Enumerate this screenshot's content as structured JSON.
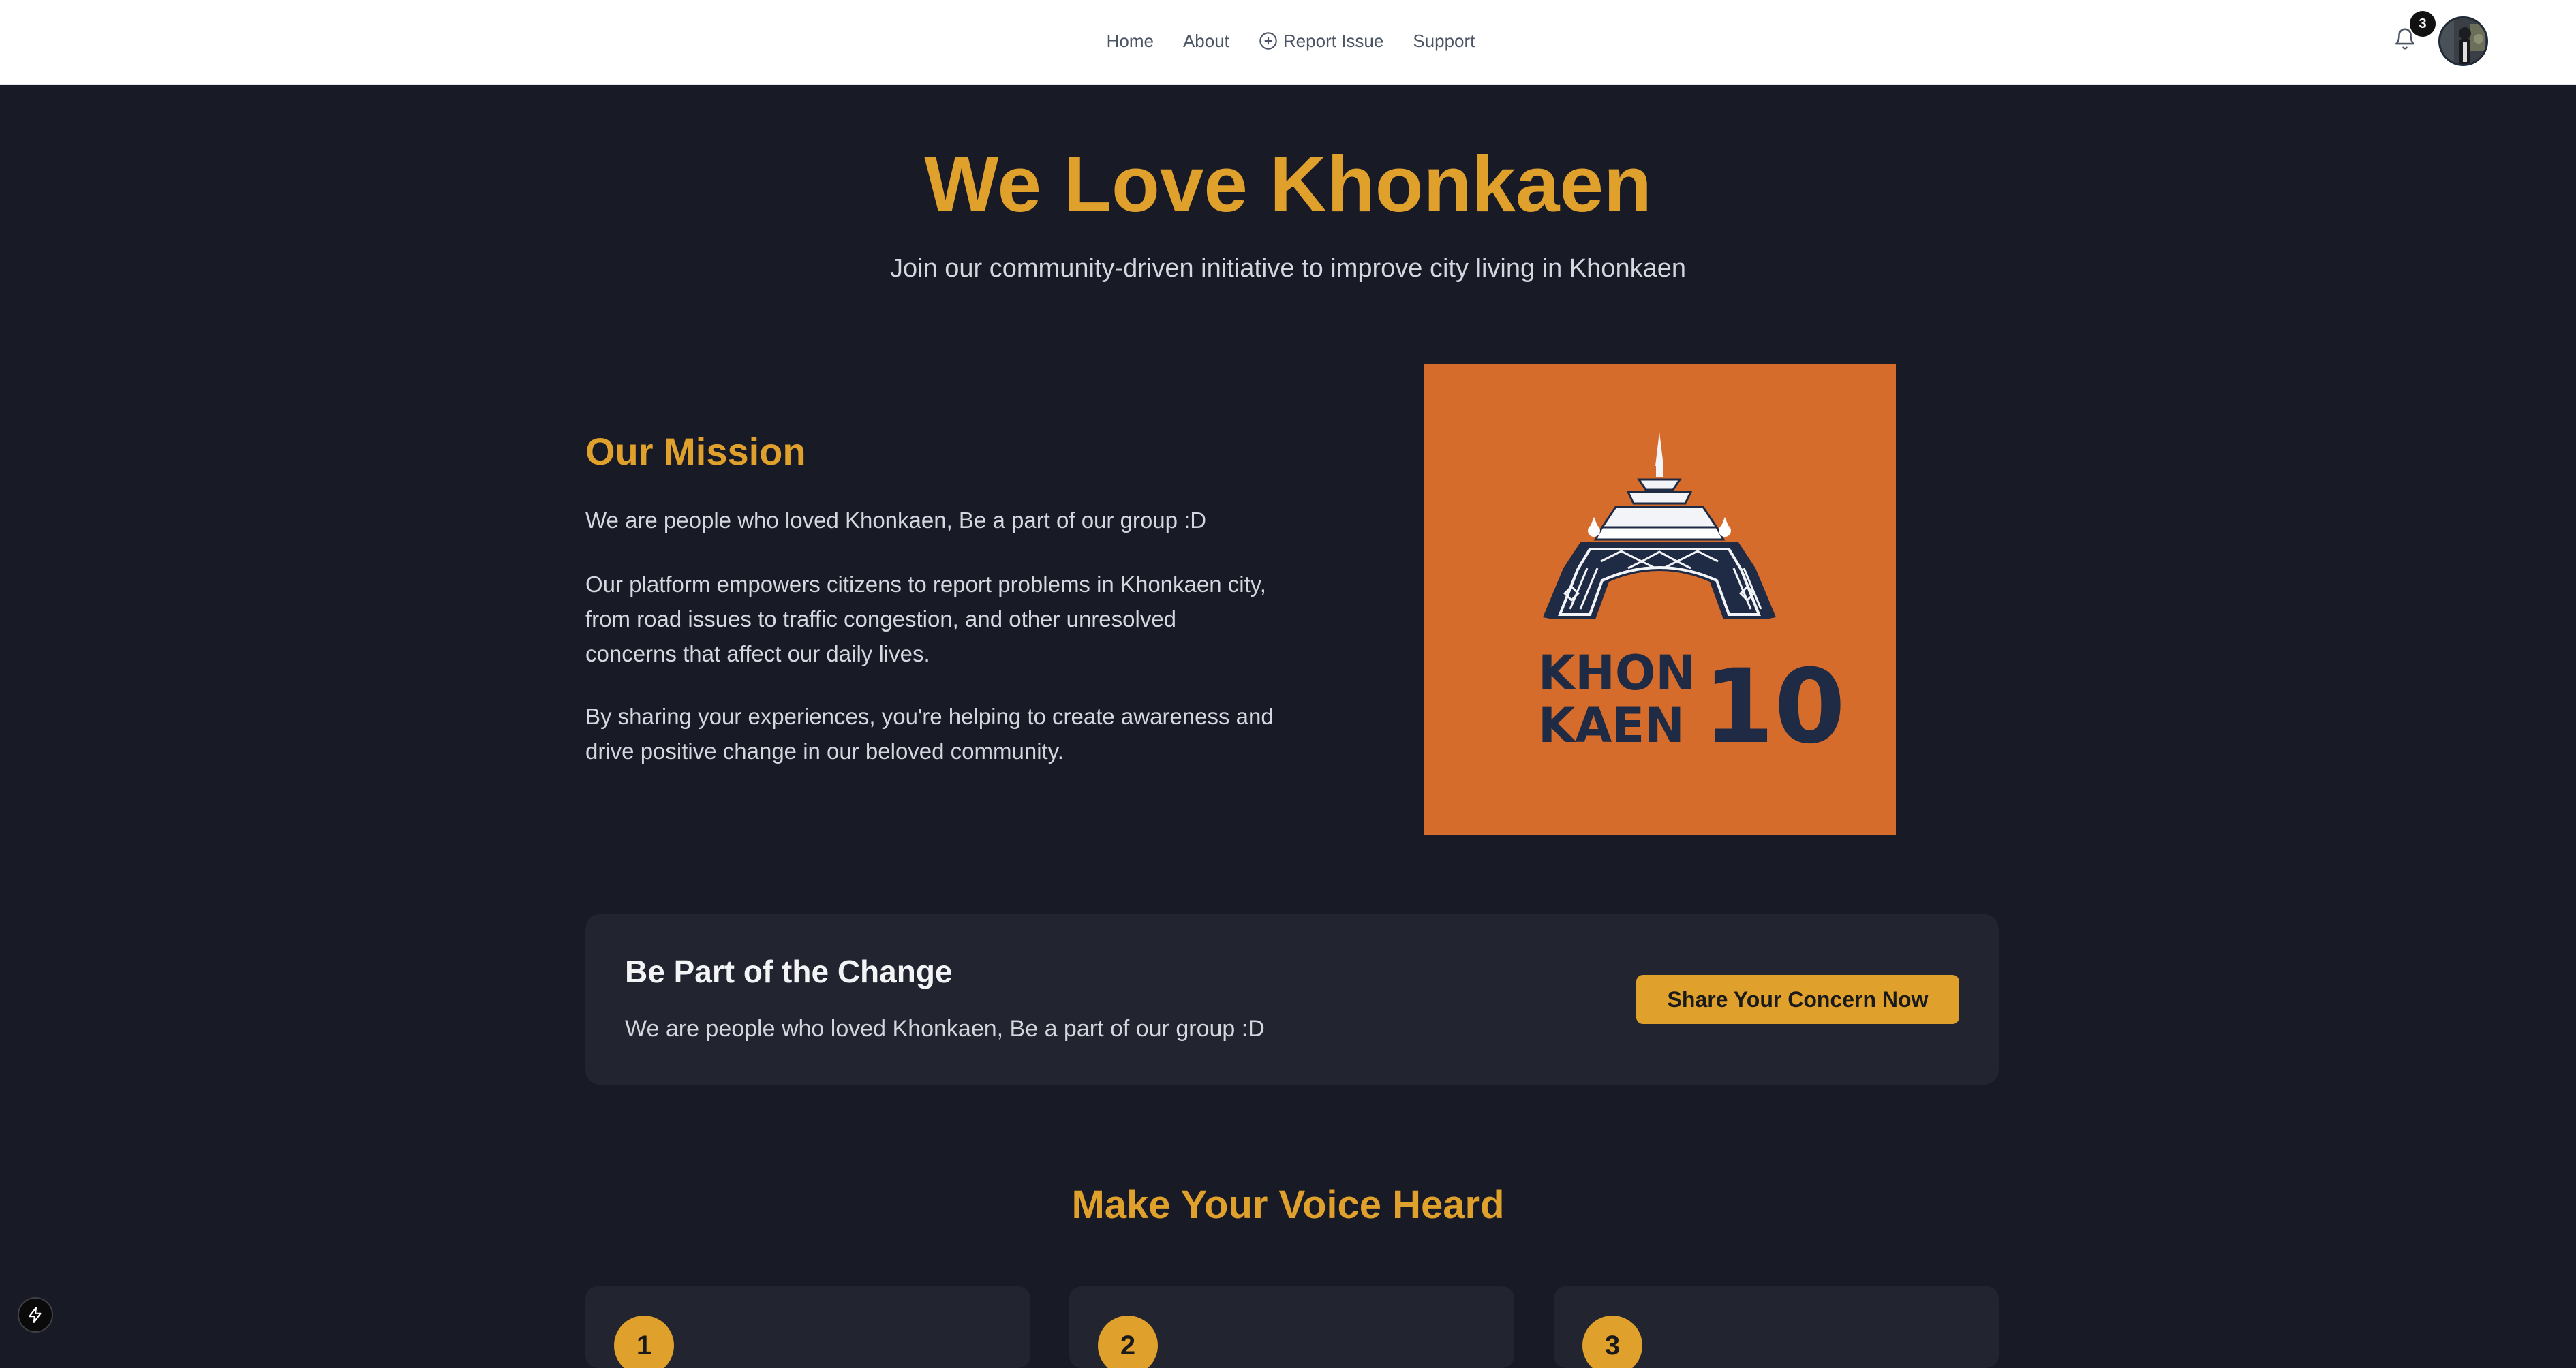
{
  "nav": {
    "items": [
      {
        "label": "Home"
      },
      {
        "label": "About"
      },
      {
        "label": "Report Issue",
        "icon": "plus-circle-icon"
      },
      {
        "label": "Support"
      }
    ],
    "notification_count": "3"
  },
  "hero": {
    "title": "We Love Khonkaen",
    "subtitle": "Join our community-driven initiative to improve city living in Khonkaen"
  },
  "mission": {
    "title": "Our Mission",
    "paragraphs": [
      "We are people who loved Khonkaen, Be a part of our group :D",
      "Our platform empowers citizens to report problems in Khonkaen city, from road issues to traffic congestion, and other unresolved concerns that affect our daily lives.",
      "By sharing your experiences, you're helping to create awareness and drive positive change in our beloved community."
    ],
    "logo": {
      "line1": "KHON",
      "line2": "KAEN",
      "number": "10",
      "background": "#d66c2b"
    }
  },
  "cta": {
    "title": "Be Part of the Change",
    "text": "We are people who loved Khonkaen, Be a part of our group :D",
    "button_label": "Share Your Concern Now"
  },
  "voice": {
    "title": "Make Your Voice Heard",
    "steps": [
      {
        "number": "1"
      },
      {
        "number": "2"
      },
      {
        "number": "3"
      }
    ]
  },
  "colors": {
    "accent": "#e0a02c",
    "page_background": "#181a26",
    "card_background": "#222530",
    "logo_background": "#d66c2b",
    "logo_ink": "#1f2a44"
  }
}
